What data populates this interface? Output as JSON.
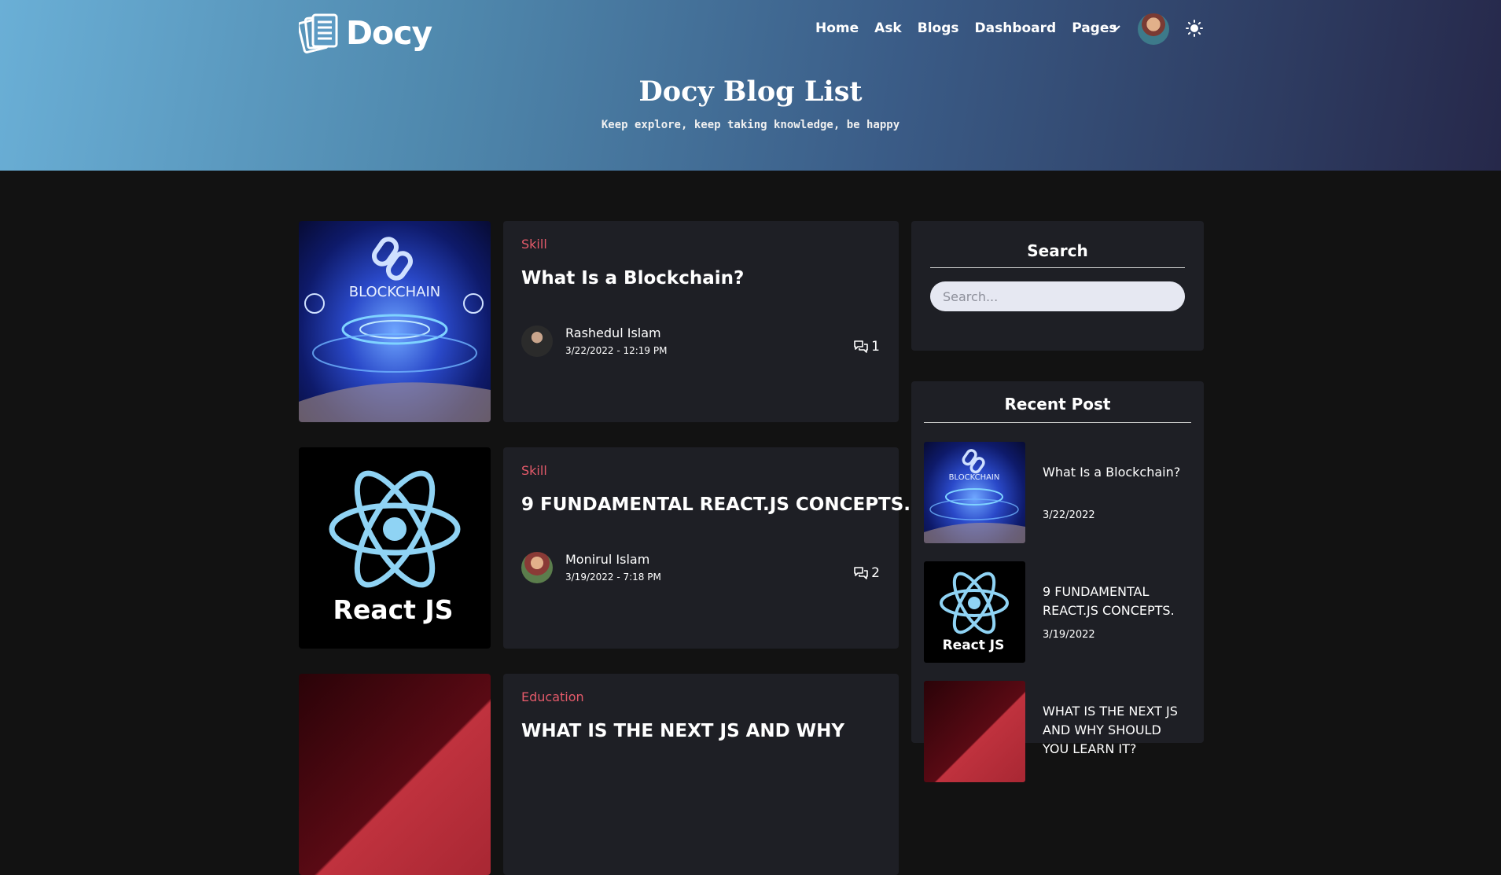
{
  "brand": {
    "name": "Docy"
  },
  "nav": {
    "items": [
      "Home",
      "Ask",
      "Blogs",
      "Dashboard",
      "Pages"
    ]
  },
  "hero": {
    "title": "Docy Blog List",
    "subtitle": "Keep explore, keep taking knowledge, be happy"
  },
  "posts": [
    {
      "category": "Skill",
      "title": "What Is a Blockchain?",
      "author": "Rashedul Islam",
      "date": "3/22/2022 - 12:19 PM",
      "comments": "1",
      "image_label": "BLOCKCHAIN"
    },
    {
      "category": "Skill",
      "title": "9 FUNDAMENTAL REACT.JS CONCEPTS.",
      "author": "Monirul Islam",
      "date": "3/19/2022 - 7:18 PM",
      "comments": "2",
      "image_label": "React JS"
    },
    {
      "category": "Education",
      "title": "WHAT IS THE NEXT JS AND WHY"
    }
  ],
  "sidebar": {
    "search": {
      "title": "Search",
      "placeholder": "Search..."
    },
    "recent": {
      "title": "Recent Post",
      "items": [
        {
          "title": "What Is a Blockchain?",
          "date": "3/22/2022",
          "image_label": "BLOCKCHAIN"
        },
        {
          "title": "9 FUNDAMENTAL REACT.JS CONCEPTS.",
          "date": "3/19/2022",
          "image_label": "React JS"
        },
        {
          "title": "WHAT IS THE NEXT JS AND WHY SHOULD YOU LEARN IT?"
        }
      ]
    }
  },
  "icons": {
    "theme_toggle": "sun-icon",
    "comments": "comment-icon",
    "dropdown": "chevron-down-icon"
  },
  "colors": {
    "accent_category": "#e45a6a",
    "card_bg": "#1e1f25",
    "page_bg": "#121212"
  }
}
